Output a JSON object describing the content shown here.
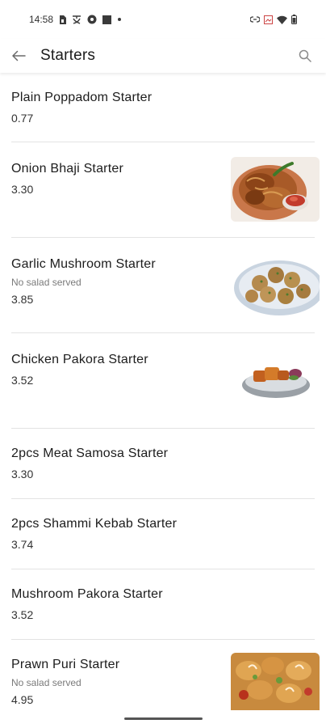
{
  "status_bar": {
    "time": "14:58",
    "icons_left": [
      "sim-card-icon",
      "translate-icon",
      "vpn-key-icon",
      "square-app-icon",
      "dot-icon"
    ],
    "icons_right": [
      "link-icon",
      "screen-cast-icon",
      "wifi-icon",
      "battery-icon"
    ]
  },
  "app_bar": {
    "back_icon": "arrow-left-icon",
    "title": "Starters",
    "search_icon": "search-icon"
  },
  "items": [
    {
      "name": "Plain Poppadom Starter",
      "note": "",
      "price": "0.77",
      "image": ""
    },
    {
      "name": "Onion Bhaji Starter",
      "note": "",
      "price": "3.30",
      "image": "onion-bhaji-photo"
    },
    {
      "name": "Garlic Mushroom Starter",
      "note": "No salad served",
      "price": "3.85",
      "image": "garlic-mushroom-photo"
    },
    {
      "name": "Chicken Pakora Starter",
      "note": "",
      "price": "3.52",
      "image": "chicken-pakora-photo"
    },
    {
      "name": "2pcs Meat Samosa Starter",
      "note": "",
      "price": "3.30",
      "image": ""
    },
    {
      "name": "2pcs Shammi Kebab Starter",
      "note": "",
      "price": "3.74",
      "image": ""
    },
    {
      "name": "Mushroom Pakora Starter",
      "note": "",
      "price": "3.52",
      "image": ""
    },
    {
      "name": "Prawn Puri Starter",
      "note": "No salad served",
      "price": "4.95",
      "image": "prawn-puri-photo"
    }
  ],
  "colors": {
    "background": "#ffffff",
    "text": "#1c1c1c",
    "secondary_text": "#7a7a7a",
    "divider": "#e3e3e3"
  }
}
